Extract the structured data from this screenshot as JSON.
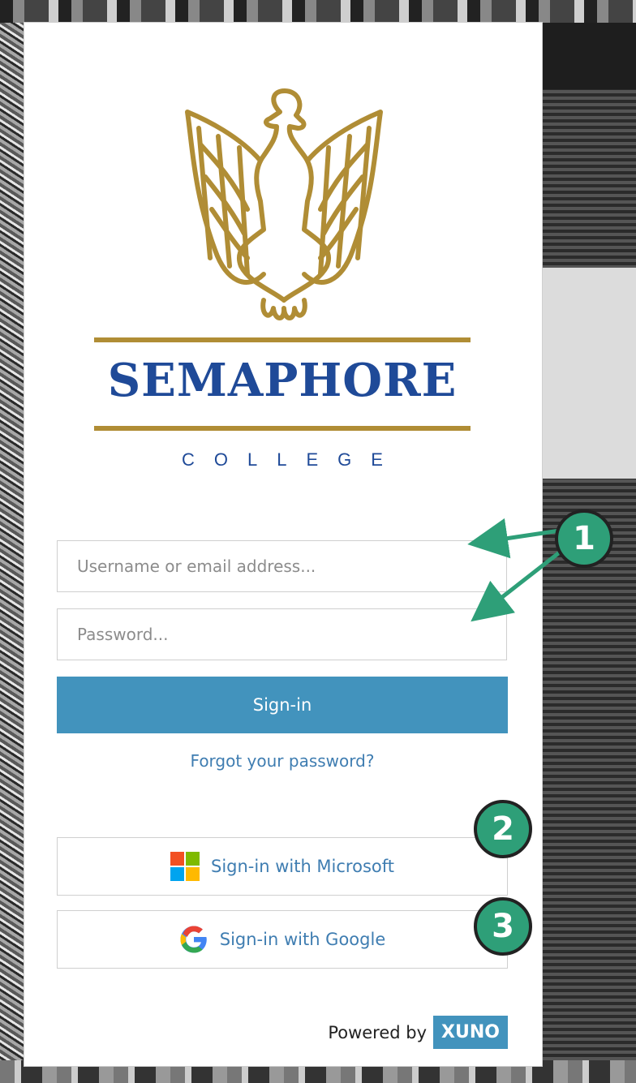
{
  "brand": {
    "name": "SEMAPHORE",
    "subtitle": "COLLEGE",
    "colors": {
      "gold": "#b08d35",
      "blue": "#1f4a98"
    }
  },
  "form": {
    "username_placeholder": "Username or email address...",
    "password_placeholder": "Password...",
    "signin_label": "Sign-in",
    "forgot_label": "Forgot your password?"
  },
  "sso": {
    "microsoft_label": "Sign-in with Microsoft",
    "google_label": "Sign-in with Google",
    "icons": [
      "microsoft-icon",
      "google-icon"
    ]
  },
  "footer": {
    "powered_by": "Powered by",
    "vendor": "XUNO"
  },
  "annotations": {
    "one": "1",
    "two": "2",
    "three": "3",
    "color": "#2e9f78"
  },
  "colors": {
    "primary": "#4293bd",
    "link": "#3f7db1"
  }
}
